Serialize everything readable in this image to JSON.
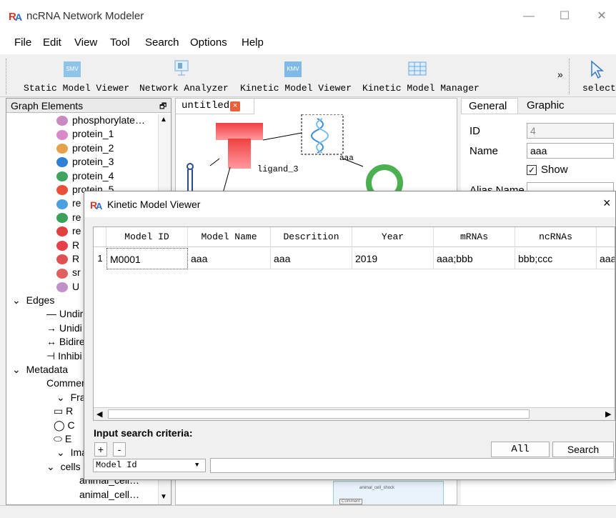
{
  "app": {
    "title": "ncRNA Network Modeler"
  },
  "menu": [
    "File",
    "Edit",
    "View",
    "Tool",
    "Search",
    "Options",
    "Help"
  ],
  "toolbar": {
    "items": [
      {
        "label": "Static Model Viewer",
        "icon_text": "SMV",
        "icon": "smv-icon"
      },
      {
        "label": "Network Analyzer",
        "icon": "network-analyzer-icon"
      },
      {
        "label": "Kinetic Model Viewer",
        "icon_text": "KMV",
        "icon": "kmv-icon"
      },
      {
        "label": "Kinetic Model Manager",
        "icon": "kinetic-model-manager-icon"
      }
    ],
    "overflow": "»",
    "select_label": "select"
  },
  "left_panel": {
    "title": "Graph Elements",
    "rows": [
      {
        "label": "phosphorylate…",
        "icon": "phosphorylated-protein-icon",
        "indent": 1
      },
      {
        "label": "protein_1",
        "icon": "protein-1-icon",
        "indent": 1
      },
      {
        "label": "protein_2",
        "icon": "protein-2-icon",
        "indent": 1
      },
      {
        "label": "protein_3",
        "icon": "protein-3-icon",
        "indent": 1
      },
      {
        "label": "protein_4",
        "icon": "protein-4-icon",
        "indent": 1
      },
      {
        "label": "protein_5",
        "icon": "protein-5-icon",
        "indent": 1
      },
      {
        "label": "re",
        "icon": "receptor-icon",
        "indent": 1
      },
      {
        "label": "re",
        "icon": "receptor-2-icon",
        "indent": 1
      },
      {
        "label": "re",
        "icon": "receptor-3-icon",
        "indent": 1
      },
      {
        "label": "R",
        "icon": "r-icon",
        "indent": 1
      },
      {
        "label": "R",
        "icon": "r-2-icon",
        "indent": 1
      },
      {
        "label": "sr",
        "icon": "sr-icon",
        "indent": 1
      },
      {
        "label": "U",
        "icon": "u-icon",
        "indent": 1
      },
      {
        "label": "Edges",
        "icon": "chevron-down-icon",
        "indent": 0
      },
      {
        "label": "— Undir",
        "icon": "",
        "indent": 2
      },
      {
        "label": "→ Unidi",
        "icon": "",
        "indent": 2
      },
      {
        "label": "↔ Bidire",
        "icon": "",
        "indent": 2
      },
      {
        "label": "⊣ Inhibi",
        "icon": "",
        "indent": 2
      },
      {
        "label": "Metadata",
        "icon": "chevron-down-icon",
        "indent": 0
      },
      {
        "label": "Commen",
        "icon": "",
        "indent": 2
      },
      {
        "label": "Frame",
        "icon": "chevron-down-icon",
        "indent": 1
      },
      {
        "label": "▭ R",
        "icon": "",
        "indent": 3
      },
      {
        "label": "◯ C",
        "icon": "",
        "indent": 3
      },
      {
        "label": "⬭ E",
        "icon": "",
        "indent": 3
      },
      {
        "label": "Image",
        "icon": "chevron-down-icon",
        "indent": 1
      },
      {
        "label": "cells",
        "icon": "chevron-down-icon",
        "indent": 2
      },
      {
        "label": "animal_cell…",
        "icon": "",
        "indent": 4
      },
      {
        "label": "animal_cell…",
        "icon": "",
        "indent": 4
      }
    ]
  },
  "canvas": {
    "tab_label": "untitled",
    "labels": {
      "ligand": "ligand_3",
      "aaa": "aaa"
    },
    "footer_note_1": "animal_cell_shock",
    "footer_note_2": "Comment"
  },
  "right_panel": {
    "tabs": [
      "General",
      "Graphic"
    ],
    "id_label": "ID",
    "id_value": "4",
    "name_label": "Name",
    "name_value": "aaa",
    "show_label": "Show",
    "alias_label": "Alias Name"
  },
  "dialog": {
    "title": "Kinetic Model Viewer",
    "close": "×",
    "columns": [
      "Model ID",
      "Model Name",
      "Descrition",
      "Year",
      "mRNAs",
      "ncRNAs",
      ""
    ],
    "rows": [
      {
        "index": "1",
        "cells": [
          "M0001",
          "aaa",
          "aaa",
          "2019",
          "aaa;bbb",
          "bbb;ccc",
          "aaa"
        ]
      }
    ],
    "search_label": "Input search criteria:",
    "plus": "+",
    "minus": "-",
    "all_button": "All",
    "search_button": "Search",
    "field_select": "Model Id",
    "search_value": ""
  },
  "colors": {
    "accent": "#5b9bd5",
    "red_node": "#e8202a",
    "green_node": "#4caf50"
  }
}
